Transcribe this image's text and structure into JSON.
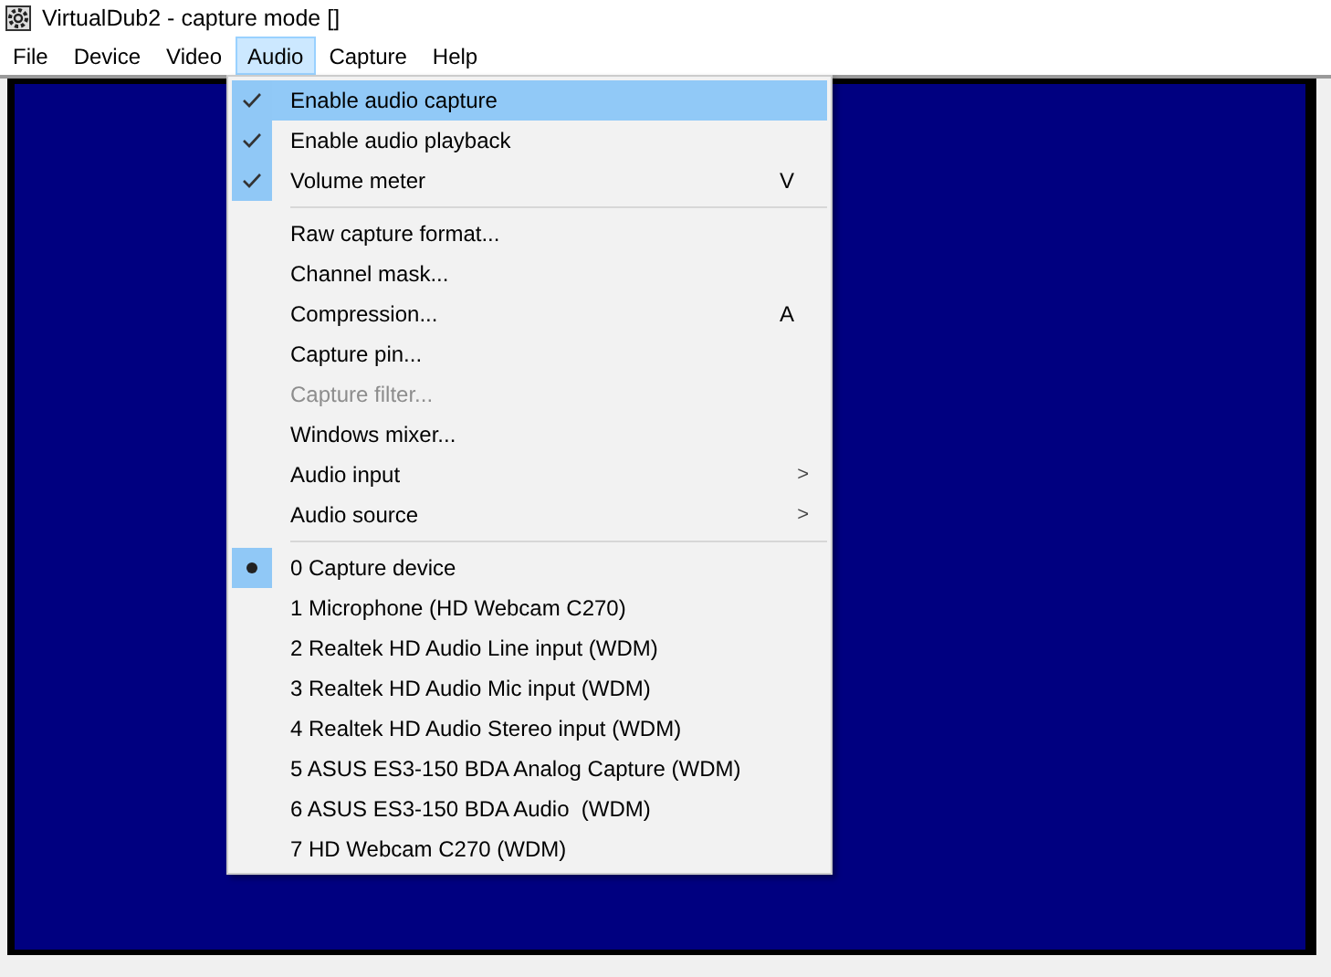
{
  "window": {
    "title": "VirtualDub2  - capture mode []"
  },
  "menu_bar": [
    {
      "label": "File",
      "selected": false
    },
    {
      "label": "Device",
      "selected": false
    },
    {
      "label": "Video",
      "selected": false
    },
    {
      "label": "Audio",
      "selected": true
    },
    {
      "label": "Capture",
      "selected": false
    },
    {
      "label": "Help",
      "selected": false
    }
  ],
  "audio_menu": [
    {
      "kind": "check",
      "label": "Enable audio capture",
      "checked": true,
      "highlighted": true
    },
    {
      "kind": "check",
      "label": "Enable audio playback",
      "checked": true,
      "highlighted": false
    },
    {
      "kind": "check",
      "label": "Volume meter",
      "checked": true,
      "highlighted": false,
      "shortcut": "V"
    },
    {
      "kind": "separator"
    },
    {
      "kind": "command",
      "label": "Raw capture format...",
      "disabled": false
    },
    {
      "kind": "command",
      "label": "Channel mask...",
      "disabled": false
    },
    {
      "kind": "command",
      "label": "Compression...",
      "disabled": false,
      "shortcut": "A"
    },
    {
      "kind": "command",
      "label": "Capture pin...",
      "disabled": false
    },
    {
      "kind": "command",
      "label": "Capture filter...",
      "disabled": true
    },
    {
      "kind": "command",
      "label": "Windows mixer...",
      "disabled": false
    },
    {
      "kind": "submenu",
      "label": "Audio input",
      "arrow": ">"
    },
    {
      "kind": "submenu",
      "label": "Audio source",
      "arrow": ">"
    },
    {
      "kind": "separator"
    },
    {
      "kind": "radio",
      "label": "0 Capture device",
      "selected": true
    },
    {
      "kind": "radio",
      "label": "1 Microphone (HD Webcam C270)",
      "selected": false
    },
    {
      "kind": "radio",
      "label": "2 Realtek HD Audio Line input (WDM)",
      "selected": false
    },
    {
      "kind": "radio",
      "label": "3 Realtek HD Audio Mic input (WDM)",
      "selected": false
    },
    {
      "kind": "radio",
      "label": "4 Realtek HD Audio Stereo input (WDM)",
      "selected": false
    },
    {
      "kind": "radio",
      "label": "5 ASUS ES3-150 BDA Analog Capture (WDM)",
      "selected": false
    },
    {
      "kind": "radio",
      "label": "6 ASUS ES3-150 BDA Audio  (WDM)",
      "selected": false
    },
    {
      "kind": "radio",
      "label": "7 HD Webcam C270 (WDM)",
      "selected": false
    }
  ]
}
